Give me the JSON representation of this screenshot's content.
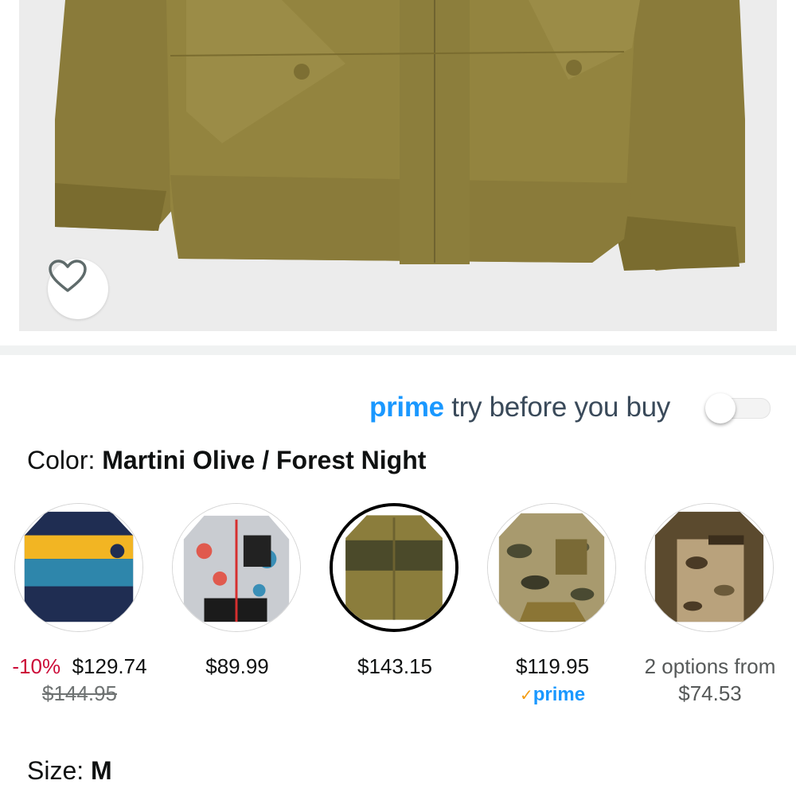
{
  "prime_banner": {
    "prime_word": "prime",
    "rest": " try before you buy",
    "toggle_on": false
  },
  "color": {
    "label": "Color: ",
    "value": "Martini Olive / Forest Night"
  },
  "swatches": [
    {
      "name": "navy-yellow-blue-jacket",
      "selected": false,
      "discount": "-10%",
      "price": "$129.74",
      "list_price": "$144.95"
    },
    {
      "name": "floral-print-jacket",
      "selected": false,
      "price": "$89.99"
    },
    {
      "name": "olive-forest-jacket",
      "selected": true,
      "price": "$143.15"
    },
    {
      "name": "camo-puffer-jacket",
      "selected": false,
      "price": "$119.95",
      "prime_check": "✓",
      "prime_label": "prime"
    },
    {
      "name": "camo-brown-jacket",
      "selected": false,
      "options_text": "2 options from",
      "from_price": "$74.53"
    }
  ],
  "size": {
    "label": "Size: ",
    "value": "M"
  },
  "colors": {
    "prime_blue": "#1a98ff",
    "discount_red": "#cc0c39",
    "jacket_olive": "#8b7d3c"
  },
  "icons": {
    "wishlist": "heart-outline-icon"
  }
}
